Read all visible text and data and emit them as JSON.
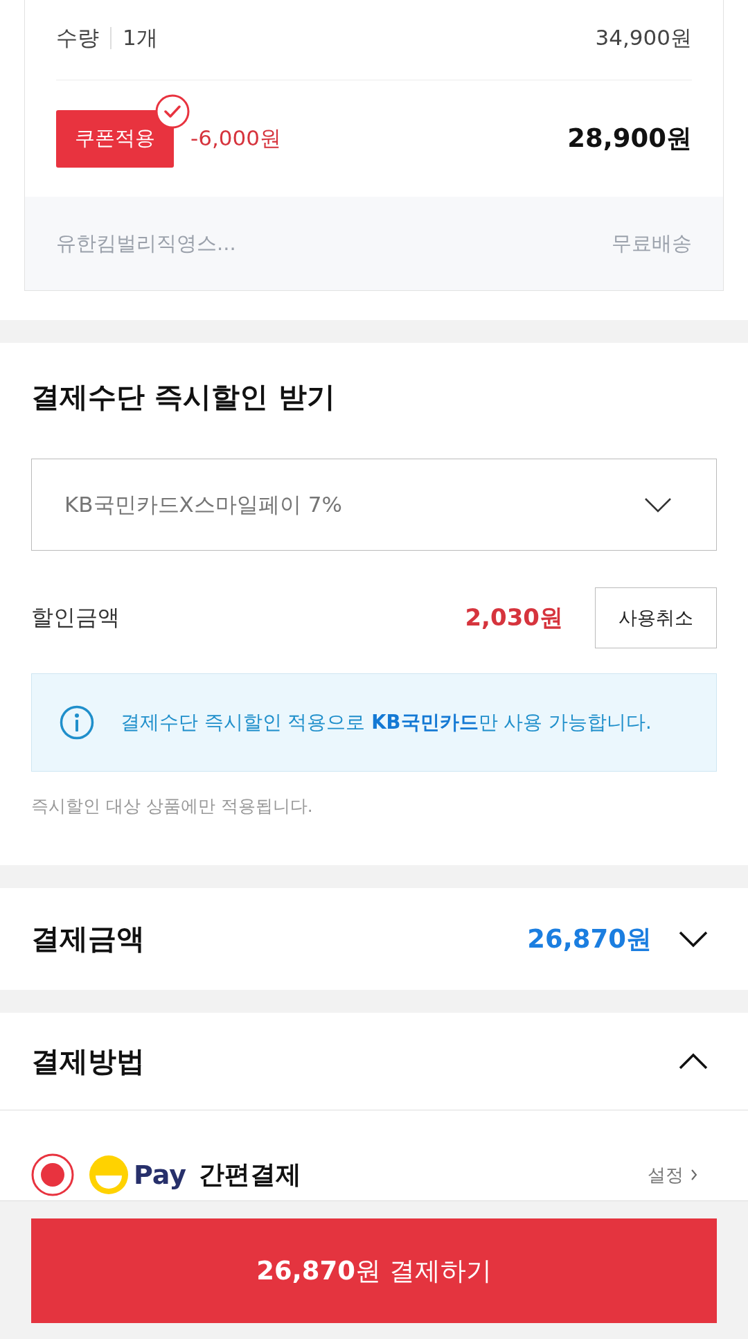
{
  "order_item": {
    "quantity_label": "수량",
    "quantity": "1개",
    "price": "34,900원",
    "coupon": {
      "label": "쿠폰적용",
      "applied": true,
      "discount": "-6,000원"
    },
    "final_price": "28,900원",
    "seller": "유한킴벌리직영스...",
    "shipping": "무료배송"
  },
  "instant_discount": {
    "title": "결제수단 즉시할인 받기",
    "card_select": {
      "value": "KB국민카드X스마일페이 7%"
    },
    "discount_label": "할인금액",
    "discount_amount": "2,030원",
    "cancel_button": "사용취소",
    "notice": "결제수단 즉시할인 적용으로 **KB국민카드**만 사용 가능합니다.",
    "footnote": "즉시할인 대상 상품에만 적용됩니다."
  },
  "payment_total": {
    "label": "결제금액",
    "amount": "26,870원",
    "expanded": false
  },
  "payment_method": {
    "title": "결제방법",
    "expanded": true,
    "options": [
      {
        "logo_text": "Pay",
        "label": "간편결제",
        "selected": true,
        "settings_link": "설정"
      }
    ]
  },
  "pay_button": "**26,870**원 결제하기"
}
